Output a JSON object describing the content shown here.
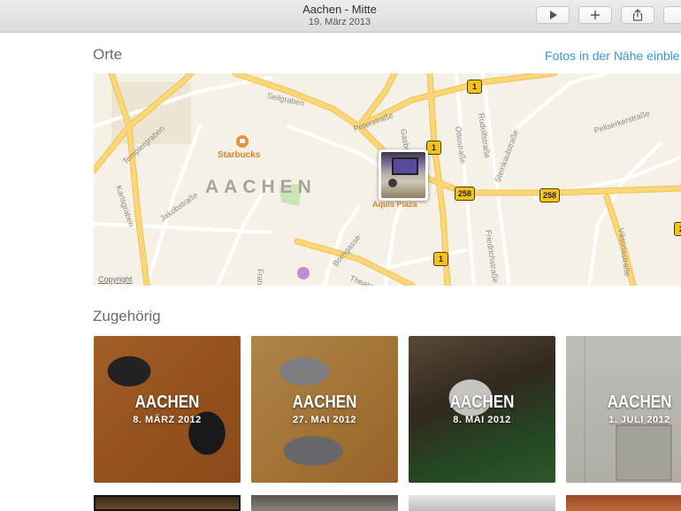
{
  "window": {
    "title": "Aachen - Mitte",
    "subtitle": "19. März 2013",
    "toolbar_buttons": [
      {
        "name": "play-button",
        "icon": "play-icon"
      },
      {
        "name": "add-button",
        "icon": "plus-icon"
      },
      {
        "name": "share-button",
        "icon": "share-icon"
      },
      {
        "name": "more-button",
        "icon": "unknown"
      }
    ]
  },
  "places": {
    "heading": "Orte",
    "nearby_link": "Fotos in der Nähe einble",
    "map": {
      "city_label": "AACHEN",
      "copyright": "Copyright",
      "poi": "Starbucks",
      "photo_pin_label": "Aquis Plaza",
      "route_badges": [
        "1",
        "1",
        "258",
        "258",
        "1",
        "2"
      ],
      "streets": [
        "Seilgraben",
        "Templergraben",
        "Peterstraße",
        "Gasborn",
        "Ottostraße",
        "Rudolfstraße",
        "Steinkaulstraße",
        "Peliserkerstraße",
        "Karlsgraben",
        "Jakobstraße",
        "Borngasse",
        "Friedrichstraße",
        "Viktoriastraße",
        "Theater",
        "Franz"
      ]
    }
  },
  "related": {
    "heading": "Zugehörig",
    "tiles": [
      {
        "city": "AACHEN",
        "date": "8. MÄRZ 2012"
      },
      {
        "city": "AACHEN",
        "date": "27. MAI 2012"
      },
      {
        "city": "AACHEN",
        "date": "8. MAI 2012"
      },
      {
        "city": "AACHEN",
        "date": "1. JULI 2012"
      }
    ]
  },
  "colors": {
    "link": "#2e9bdd",
    "map_background": "#f5f1e7",
    "road_major": "#fbd77a",
    "route_badge": "#f4c317"
  }
}
